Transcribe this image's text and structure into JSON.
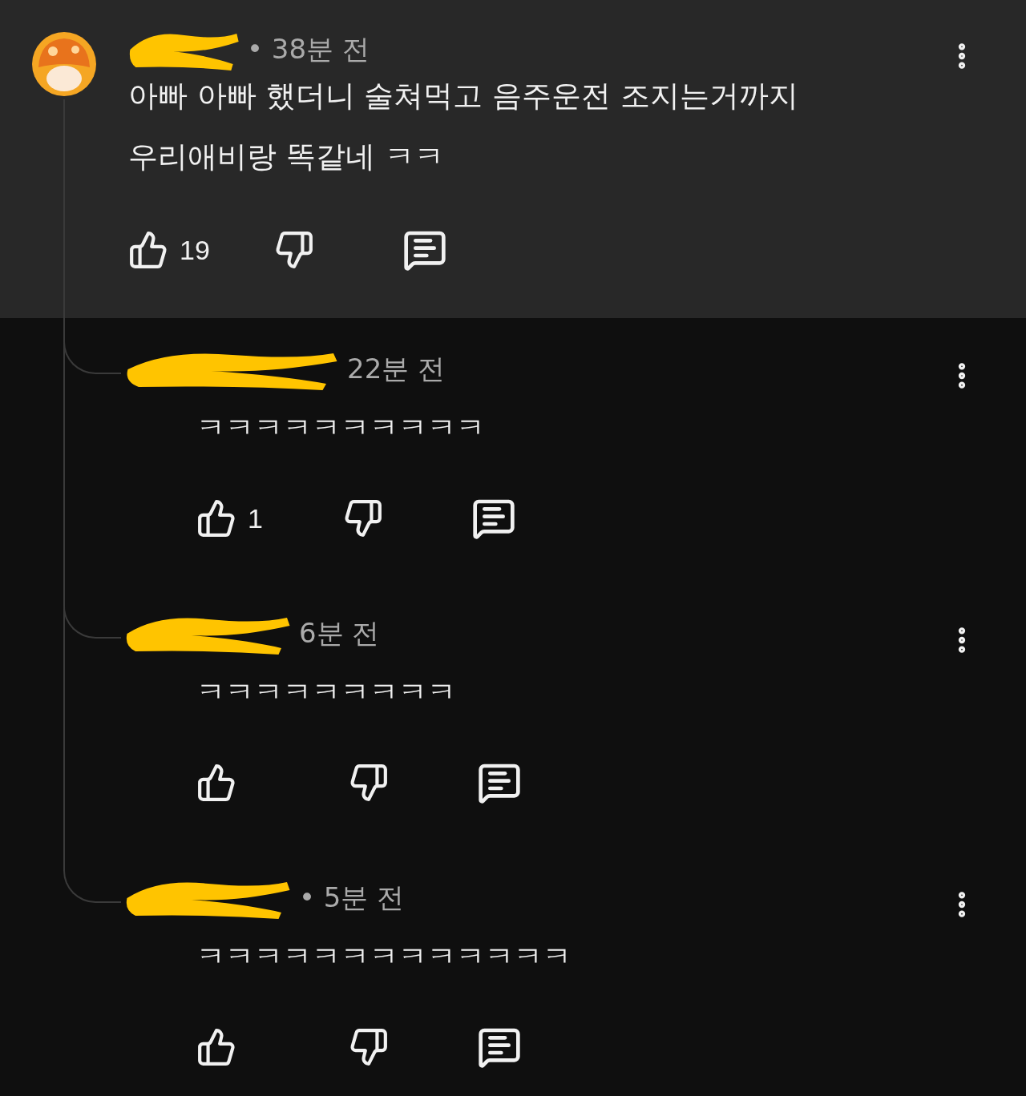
{
  "comment": {
    "time": "• 38분 전",
    "text_lines": [
      "아빠 아빠 했더니 술쳐먹고 음주운전 조지는거까지",
      "우리애비랑 똑같네 ㅋㅋ"
    ],
    "likes": "19"
  },
  "replies": [
    {
      "time": "22분 전",
      "text": "ㅋㅋㅋㅋㅋㅋㅋㅋㅋㅋ",
      "likes": "1"
    },
    {
      "time": "6분 전",
      "text": "ㅋㅋㅋㅋㅋㅋㅋㅋㅋ"
    },
    {
      "time": "• 5분 전",
      "text": "ㅋㅋㅋㅋㅋㅋㅋㅋㅋㅋㅋㅋㅋ"
    }
  ]
}
